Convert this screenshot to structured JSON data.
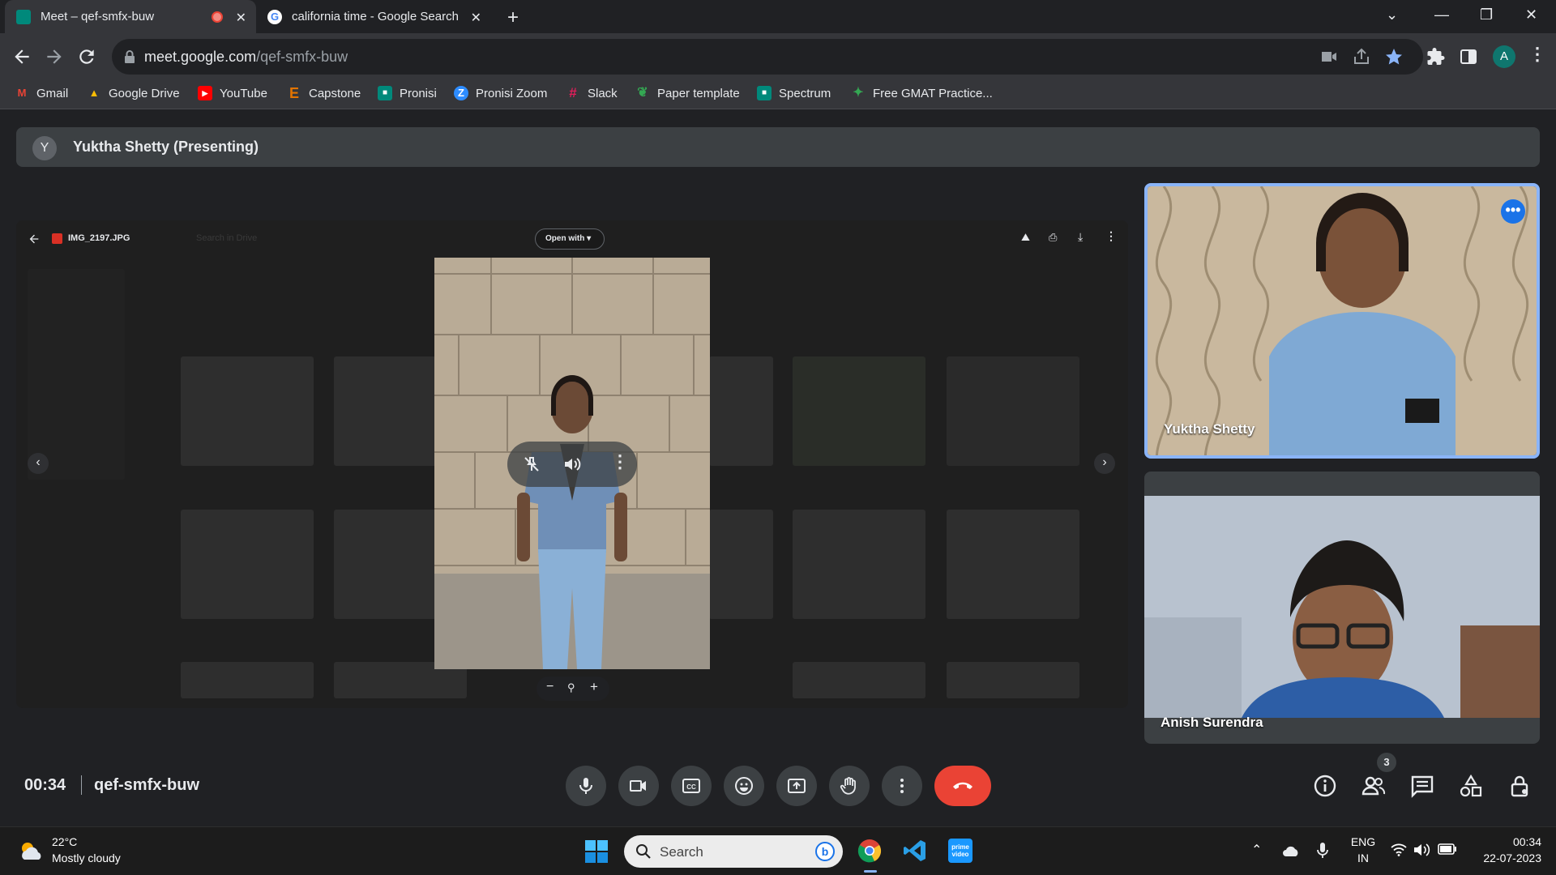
{
  "browser": {
    "tabs": [
      {
        "title": "Meet – qef-smfx-buw",
        "active": true
      },
      {
        "title": "california time - Google Search",
        "active": false
      }
    ],
    "url_host": "meet.google.com",
    "url_path": "/qef-smfx-buw",
    "profile_initial": "A"
  },
  "bookmarks": [
    {
      "label": "Gmail",
      "icon": "gmail-icon",
      "color": "#ea4335",
      "glyph": "M"
    },
    {
      "label": "Google Drive",
      "icon": "drive-icon",
      "color": "#1fa463",
      "glyph": "▲"
    },
    {
      "label": "YouTube",
      "icon": "youtube-icon",
      "color": "#ff0000",
      "glyph": "▶"
    },
    {
      "label": "Capstone",
      "icon": "capstone-icon",
      "color": "#e37400",
      "glyph": "E"
    },
    {
      "label": "Pronisi",
      "icon": "meet-icon",
      "color": "#00897b",
      "glyph": "■"
    },
    {
      "label": "Pronisi Zoom",
      "icon": "zoom-icon",
      "color": "#2d8cff",
      "glyph": "Z"
    },
    {
      "label": "Slack",
      "icon": "slack-icon",
      "color": "#e01e5a",
      "glyph": "#"
    },
    {
      "label": "Paper template",
      "icon": "leaf-icon",
      "color": "#34a853",
      "glyph": "❦"
    },
    {
      "label": "Spectrum",
      "icon": "meet-icon",
      "color": "#00897b",
      "glyph": "■"
    },
    {
      "label": "Free GMAT Practice...",
      "icon": "gmat-icon",
      "color": "#188038",
      "glyph": "✦"
    }
  ],
  "meeting": {
    "presenter_initial": "Y",
    "presenting_label": "Yuktha Shetty (Presenting)",
    "time": "00:34",
    "code": "qef-smfx-buw",
    "participant_count": "3",
    "participants": [
      {
        "name": "Yuktha Shetty"
      },
      {
        "name": "Anish Surendra"
      }
    ]
  },
  "shared_screen": {
    "file_name": "IMG_2197.JPG",
    "open_with_label": "Open with",
    "search_placeholder": "Search in Drive"
  },
  "taskbar": {
    "temperature": "22°C",
    "weather": "Mostly cloudy",
    "search_label": "Search",
    "language": "ENG",
    "region": "IN",
    "clock_time": "00:34",
    "clock_date": "22-07-2023"
  },
  "colors": {
    "accent": "#1a73e8",
    "hangup": "#ea4335",
    "surface": "#202124",
    "control": "#3c4043"
  }
}
